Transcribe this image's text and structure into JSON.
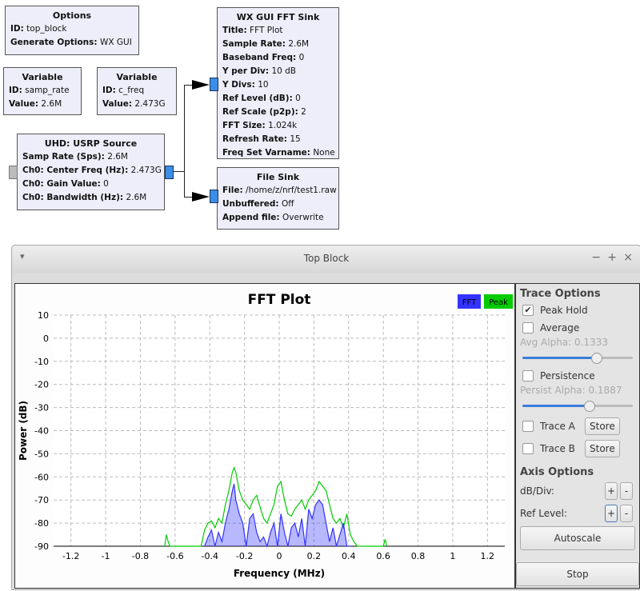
{
  "blocks": {
    "options": {
      "title": "Options",
      "rows": [
        [
          "ID:",
          "top_block"
        ],
        [
          "Generate Options:",
          "WX GUI"
        ]
      ]
    },
    "var1": {
      "title": "Variable",
      "rows": [
        [
          "ID:",
          "samp_rate"
        ],
        [
          "Value:",
          "2.6M"
        ]
      ]
    },
    "var2": {
      "title": "Variable",
      "rows": [
        [
          "ID:",
          "c_freq"
        ],
        [
          "Value:",
          "2.473G"
        ]
      ]
    },
    "usrp": {
      "title": "UHD: USRP Source",
      "rows": [
        [
          "Samp Rate (Sps):",
          "2.6M"
        ],
        [
          "Ch0: Center Freq (Hz):",
          "2.473G"
        ],
        [
          "Ch0: Gain Value:",
          "0"
        ],
        [
          "Ch0: Bandwidth (Hz):",
          "2.6M"
        ]
      ]
    },
    "fft": {
      "title": "WX GUI FFT Sink",
      "rows": [
        [
          "Title:",
          "FFT Plot"
        ],
        [
          "Sample Rate:",
          "2.6M"
        ],
        [
          "Baseband Freq:",
          "0"
        ],
        [
          "Y per Div:",
          "10 dB"
        ],
        [
          "Y Divs:",
          "10"
        ],
        [
          "Ref Level (dB):",
          "0"
        ],
        [
          "Ref Scale (p2p):",
          "2"
        ],
        [
          "FFT Size:",
          "1.024k"
        ],
        [
          "Refresh Rate:",
          "15"
        ],
        [
          "Freq Set Varname:",
          "None"
        ]
      ]
    },
    "filesink": {
      "title": "File Sink",
      "rows": [
        [
          "File:",
          "/home/z/nrf/test1.raw"
        ],
        [
          "Unbuffered:",
          "Off"
        ],
        [
          "Append file:",
          "Overwrite"
        ]
      ]
    }
  },
  "window": {
    "title": "Top Block",
    "min": "−",
    "max": "+",
    "close": "×",
    "menu": "▾"
  },
  "side": {
    "trace_options": "Trace Options",
    "peak_hold": "Peak Hold",
    "peak_checked": true,
    "average": "Average",
    "avg_alpha": "Avg Alpha: 0.1333",
    "avg_alpha_value": 0.1333,
    "avg_slider": 0.67,
    "persistence": "Persistence",
    "persist_alpha": "Persist Alpha: 0.1887",
    "persist_slider": 0.6,
    "trace_a": "Trace A",
    "trace_b": "Trace B",
    "store": "Store",
    "axis_options": "Axis Options",
    "db_div": "dB/Div:",
    "ref_level": "Ref Level:",
    "plus": "+",
    "minus": "-",
    "autoscale": "Autoscale",
    "stop": "Stop"
  },
  "chart_data": {
    "type": "line",
    "title": "FFT Plot",
    "xlabel": "Frequency (MHz)",
    "ylabel": "Power (dB)",
    "xlim": [
      -1.3,
      1.3
    ],
    "ylim": [
      -90,
      10
    ],
    "grid": true,
    "legend_placement": "top-right",
    "xticks": [
      -1.2,
      -1,
      -0.8,
      -0.6,
      -0.4,
      -0.2,
      0,
      0.2,
      0.4,
      0.6,
      0.8,
      1,
      1.2
    ],
    "yticks": [
      10,
      0,
      -10,
      -20,
      -30,
      -40,
      -50,
      -60,
      -70,
      -80,
      -90
    ],
    "series": [
      {
        "name": "Peak",
        "color": "#00cc00",
        "x": [
          -0.66,
          -0.65,
          -0.64,
          -0.63,
          -0.45,
          -0.43,
          -0.41,
          -0.39,
          -0.37,
          -0.35,
          -0.33,
          -0.31,
          -0.29,
          -0.27,
          -0.26,
          -0.25,
          -0.23,
          -0.21,
          -0.19,
          -0.17,
          -0.15,
          -0.13,
          -0.11,
          -0.09,
          -0.07,
          -0.05,
          -0.03,
          -0.01,
          0.01,
          0.03,
          0.05,
          0.07,
          0.09,
          0.11,
          0.13,
          0.15,
          0.17,
          0.19,
          0.21,
          0.23,
          0.25,
          0.27,
          0.29,
          0.31,
          0.33,
          0.35,
          0.37,
          0.39,
          0.41,
          0.43,
          0.45,
          0.5,
          0.6,
          0.61,
          0.62
        ],
        "values": [
          -90,
          -85,
          -88,
          -90,
          -90,
          -83,
          -80,
          -79,
          -82,
          -78,
          -80,
          -72,
          -66,
          -58,
          -56,
          -58,
          -66,
          -70,
          -72,
          -74,
          -70,
          -68,
          -73,
          -78,
          -80,
          -76,
          -72,
          -64,
          -62,
          -70,
          -76,
          -77,
          -74,
          -72,
          -70,
          -74,
          -70,
          -68,
          -66,
          -62,
          -64,
          -66,
          -72,
          -78,
          -80,
          -78,
          -82,
          -76,
          -85,
          -88,
          -90,
          -90,
          -90,
          -87,
          -90
        ]
      },
      {
        "name": "FFT",
        "color": "#3333ff",
        "x": [
          -0.43,
          -0.41,
          -0.39,
          -0.37,
          -0.35,
          -0.33,
          -0.31,
          -0.29,
          -0.27,
          -0.26,
          -0.25,
          -0.23,
          -0.21,
          -0.19,
          -0.17,
          -0.15,
          -0.13,
          -0.11,
          -0.09,
          -0.07,
          -0.05,
          -0.03,
          -0.01,
          0.01,
          0.03,
          0.05,
          0.07,
          0.09,
          0.11,
          0.13,
          0.15,
          0.17,
          0.19,
          0.21,
          0.23,
          0.25,
          0.27,
          0.29,
          0.31,
          0.33,
          0.35,
          0.37,
          0.39,
          0.41
        ],
        "values": [
          -90,
          -86,
          -83,
          -90,
          -84,
          -88,
          -80,
          -74,
          -66,
          -63,
          -70,
          -76,
          -80,
          -90,
          -78,
          -76,
          -84,
          -88,
          -86,
          -90,
          -84,
          -80,
          -90,
          -76,
          -84,
          -90,
          -82,
          -80,
          -86,
          -78,
          -90,
          -74,
          -78,
          -72,
          -70,
          -72,
          -80,
          -88,
          -82,
          -90,
          -85,
          -80,
          -90,
          -90
        ]
      }
    ]
  }
}
